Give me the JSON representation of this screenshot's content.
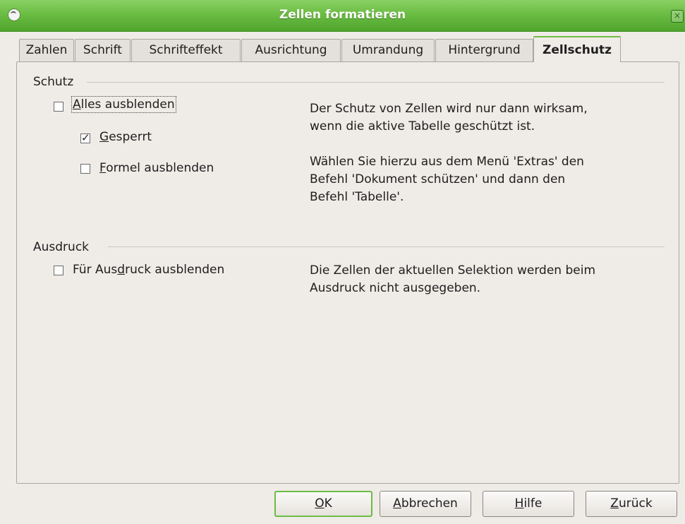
{
  "window": {
    "title": "Zellen formatieren",
    "close_glyph": "×"
  },
  "tabs": [
    {
      "label": "Zahlen",
      "active": false
    },
    {
      "label": "Schrift",
      "active": false
    },
    {
      "label": "Schrifteffekt",
      "active": false
    },
    {
      "label": "Ausrichtung",
      "active": false
    },
    {
      "label": "Umrandung",
      "active": false
    },
    {
      "label": "Hintergrund",
      "active": false
    },
    {
      "label": "Zellschutz",
      "active": true
    }
  ],
  "schutz": {
    "label": "Schutz",
    "options": [
      {
        "mnemonic": "A",
        "rest": "lles ausblenden",
        "checked": false
      },
      {
        "mnemonic": "G",
        "rest": "esperrt",
        "checked": true
      },
      {
        "mnemonic": "F",
        "rest": "ormel ausblenden",
        "checked": false
      }
    ],
    "description_1": "Der Schutz von Zellen wird nur dann wirksam,\nwenn die aktive Tabelle geschützt ist.",
    "description_2": "Wählen Sie hierzu aus dem Menü 'Extras' den\nBefehl 'Dokument schützen' und dann den\nBefehl 'Tabelle'."
  },
  "ausdruck": {
    "label": "Ausdruck",
    "option": {
      "before": "Für Aus",
      "mnemonic": "d",
      "after": "ruck ausblenden",
      "checked": false
    },
    "description": "Die Zellen der aktuellen Selektion werden beim\nAusdruck nicht ausgegeben."
  },
  "buttons": {
    "ok": {
      "mnemonic": "O",
      "rest": "K"
    },
    "cancel": {
      "mnemonic": "A",
      "rest": "bbrechen"
    },
    "help": {
      "mnemonic": "H",
      "rest": "ilfe"
    },
    "reset": {
      "mnemonic": "Z",
      "rest": "urück"
    }
  },
  "colors": {
    "titlebar": "#6bbd43",
    "title_text": "#ffffff",
    "window_bg": "#efebe7"
  },
  "icons": {
    "app": "app-icon",
    "close": "close-icon",
    "check": "checkmark-icon"
  }
}
